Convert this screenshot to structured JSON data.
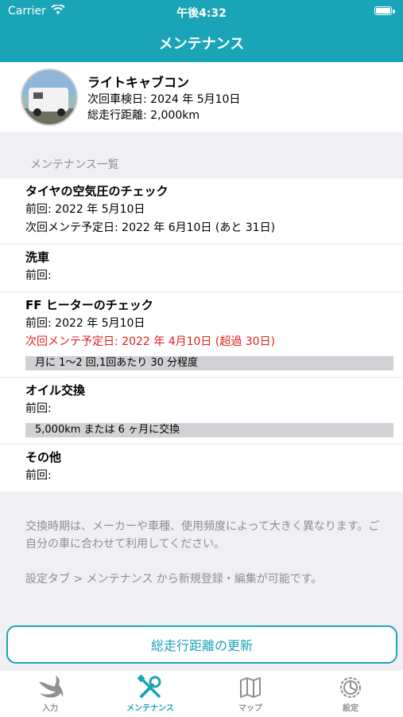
{
  "status_bar": {
    "carrier": "Carrier",
    "time": "午後4:32"
  },
  "nav": {
    "title": "メンテナンス"
  },
  "vehicle": {
    "name": "ライトキャブコン",
    "inspection": "次回車検日: 2024 年 5月10日",
    "mileage": "総走行距離: 2,000km"
  },
  "section_header": "メンテナンス一覧",
  "items": [
    {
      "title": "タイヤの空気圧のチェック",
      "last": "前回: 2022 年 5月10日",
      "next": "次回メンテ予定日: 2022 年 6月10日 (あと 31日)"
    },
    {
      "title": "洗車",
      "last": "前回:"
    },
    {
      "title": "FF ヒーターのチェック",
      "last": "前回: 2022 年 5月10日",
      "next": "次回メンテ予定日: 2022 年 4月10日 (超過 30日)",
      "note": "月に 1〜2 回,1回あたり 30 分程度"
    },
    {
      "title": "オイル交換",
      "last": "前回:",
      "note": "5,000km または 6 ヶ月に交換"
    },
    {
      "title": "その他",
      "last": "前回:"
    }
  ],
  "footer": {
    "note1": "交換時期は、メーカーや車種、使用頻度によって大きく異なります。ご自分の車に合わせて利用してください。",
    "note2": "設定タブ > メンテナンス から新規登録・編集が可能です。"
  },
  "update_button": "総走行距離の更新",
  "tabs": [
    {
      "label": "入力",
      "icon": "swift-bird-icon"
    },
    {
      "label": "メンテナンス",
      "icon": "wrench-screwdriver-icon"
    },
    {
      "label": "マップ",
      "icon": "map-icon"
    },
    {
      "label": "設定",
      "icon": "gear-icon"
    }
  ],
  "colors": {
    "accent": "#1aa4b8",
    "overdue": "#e0201c"
  }
}
